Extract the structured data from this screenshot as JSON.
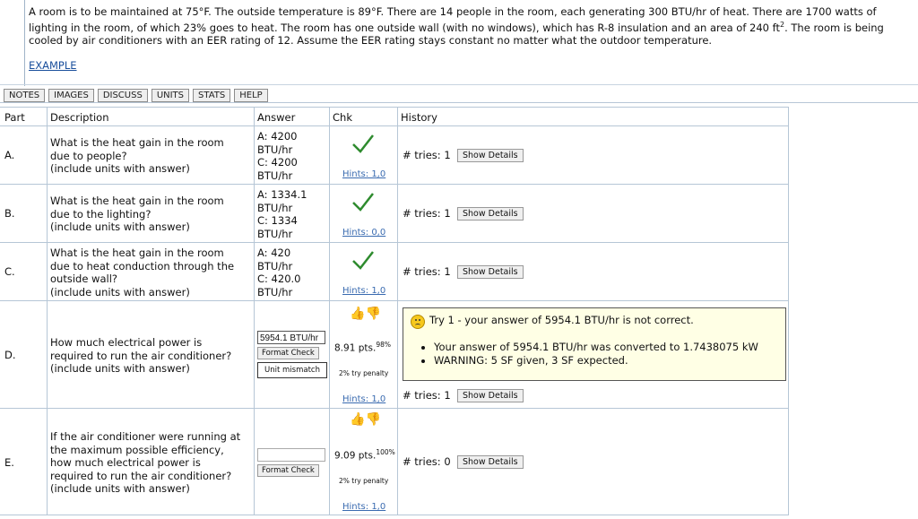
{
  "problem": {
    "text_part1": "A room is to be maintained at 75°F. The outside temperature is 89°F. There are 14 people in the room, each generating 300 BTU/hr of heat. There are 1700 watts of lighting in the room, of which 23% goes to heat. The room has one outside wall (with no windows), which has R-8 insulation and an area of 240 ft",
    "sup": "2",
    "text_part2": ". The room is being cooled by air conditioners with an EER rating of 12. Assume the EER rating stays constant no matter what the outdoor temperature.",
    "example_link": "EXAMPLE"
  },
  "tabs": [
    "NOTES",
    "IMAGES",
    "DISCUSS",
    "UNITS",
    "STATS",
    "HELP"
  ],
  "table": {
    "headers": {
      "part": "Part",
      "description": "Description",
      "answer": "Answer",
      "chk": "Chk",
      "history": "History"
    },
    "rows": [
      {
        "part": "A.",
        "description": [
          "What is the heat gain in the room",
          "due to people?",
          "(include units with answer)"
        ],
        "answer": [
          "A: 4200",
          "BTU/hr",
          "C: 4200",
          "BTU/hr"
        ],
        "hints": "Hints: 1,0",
        "tries": "# tries: 1",
        "show_details": "Show Details"
      },
      {
        "part": "B.",
        "description": [
          "What is the heat gain in the room",
          "due to the lighting?",
          "(include units with answer)"
        ],
        "answer": [
          "A: 1334.1",
          "BTU/hr",
          "C: 1334",
          "BTU/hr"
        ],
        "hints": "Hints: 0,0",
        "tries": "# tries: 1",
        "show_details": "Show Details"
      },
      {
        "part": "C.",
        "description": [
          "What is the heat gain in the room",
          "due to heat conduction through the",
          "outside wall?",
          "(include units with answer)"
        ],
        "answer": [
          "A: 420",
          "BTU/hr",
          "C: 420.0",
          "BTU/hr"
        ],
        "hints": "Hints: 1,0",
        "tries": "# tries: 1",
        "show_details": "Show Details"
      },
      {
        "part": "D.",
        "description": [
          "How much electrical power is",
          "required to run the air conditioner?",
          "(include units with answer)"
        ],
        "input_value": "5954.1 BTU/hr",
        "format_check": "Format Check",
        "unit_mismatch": "Unit mismatch",
        "points": "8.91 pts.",
        "points_pct": "98%",
        "penalty": "2% try penalty",
        "hints": "Hints: 1,0",
        "tries": "# tries: 1",
        "show_details": "Show Details",
        "feedback": {
          "title": "Try 1 - your answer of 5954.1 BTU/hr is not correct.",
          "bullets": [
            "Your answer of 5954.1 BTU/hr was converted to 1.7438075 kW",
            "WARNING: 5 SF given, 3 SF expected."
          ]
        }
      },
      {
        "part": "E.",
        "description": [
          "If the air conditioner were running at",
          "the maximum possible efficiency,",
          "how much electrical power is",
          "required to run the air conditioner?",
          "(include units with answer)"
        ],
        "input_value": "",
        "format_check": "Format Check",
        "points": "9.09 pts.",
        "points_pct": "100%",
        "penalty": "2% try penalty",
        "hints": "Hints: 1,0",
        "tries": "# tries: 0",
        "show_details": "Show Details"
      }
    ]
  },
  "colors": {
    "check": "#2e8b2e",
    "link": "#1a4f9c",
    "feedback_bg": "#ffffe5",
    "thumb_up": "#3aa83a",
    "thumb_down": "#d23c3c"
  }
}
